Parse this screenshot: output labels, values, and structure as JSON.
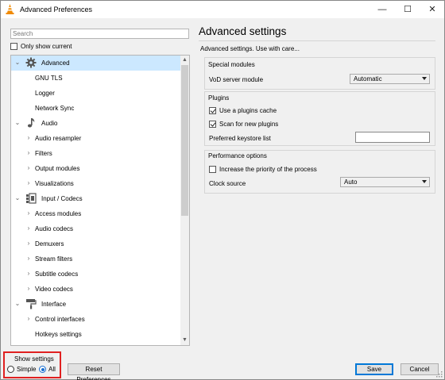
{
  "window": {
    "title": "Advanced Preferences",
    "minimize": "—",
    "maximize": "☐",
    "close": "✕"
  },
  "search": {
    "placeholder": "Search"
  },
  "only_show_current": {
    "label": "Only show current",
    "checked": false
  },
  "tree": {
    "selected": "Advanced",
    "items": [
      {
        "label": "Advanced",
        "level": 0,
        "expanded": true,
        "icon": "gear-icon"
      },
      {
        "label": "GNU TLS",
        "level": 1
      },
      {
        "label": "Logger",
        "level": 1
      },
      {
        "label": "Network Sync",
        "level": 1
      },
      {
        "label": "Audio",
        "level": 0,
        "expanded": true,
        "icon": "music-note-icon"
      },
      {
        "label": "Audio resampler",
        "level": 1,
        "collapsed": true
      },
      {
        "label": "Filters",
        "level": 1,
        "collapsed": true
      },
      {
        "label": "Output modules",
        "level": 1,
        "collapsed": true
      },
      {
        "label": "Visualizations",
        "level": 1,
        "collapsed": true
      },
      {
        "label": "Input / Codecs",
        "level": 0,
        "expanded": true,
        "icon": "codec-icon"
      },
      {
        "label": "Access modules",
        "level": 1,
        "collapsed": true
      },
      {
        "label": "Audio codecs",
        "level": 1,
        "collapsed": true
      },
      {
        "label": "Demuxers",
        "level": 1,
        "collapsed": true
      },
      {
        "label": "Stream filters",
        "level": 1,
        "collapsed": true
      },
      {
        "label": "Subtitle codecs",
        "level": 1,
        "collapsed": true
      },
      {
        "label": "Video codecs",
        "level": 1,
        "collapsed": true
      },
      {
        "label": "Interface",
        "level": 0,
        "expanded": true,
        "icon": "paint-roller-icon"
      },
      {
        "label": "Control interfaces",
        "level": 1,
        "collapsed": true
      },
      {
        "label": "Hotkeys settings",
        "level": 1
      }
    ]
  },
  "panel": {
    "title": "Advanced settings",
    "subtitle": "Advanced settings. Use with care...",
    "special_modules": {
      "title": "Special modules",
      "vod_label": "VoD server module",
      "vod_value": "Automatic"
    },
    "plugins": {
      "title": "Plugins",
      "use_cache_label": "Use a plugins cache",
      "use_cache_checked": true,
      "scan_label": "Scan for new plugins",
      "scan_checked": true,
      "keystore_label": "Preferred keystore list",
      "keystore_value": ""
    },
    "performance": {
      "title": "Performance options",
      "priority_label": "Increase the priority of the process",
      "priority_checked": false,
      "clock_label": "Clock source",
      "clock_value": "Auto"
    }
  },
  "footer": {
    "show_settings_label": "Show settings",
    "simple_label": "Simple",
    "all_label": "All",
    "selected_mode": "All",
    "reset_label": "Reset Preferences",
    "save_label": "Save",
    "cancel_label": "Cancel"
  },
  "colors": {
    "selection": "#cce8ff",
    "highlight_box": "#e02020",
    "accent": "#0078d7"
  }
}
